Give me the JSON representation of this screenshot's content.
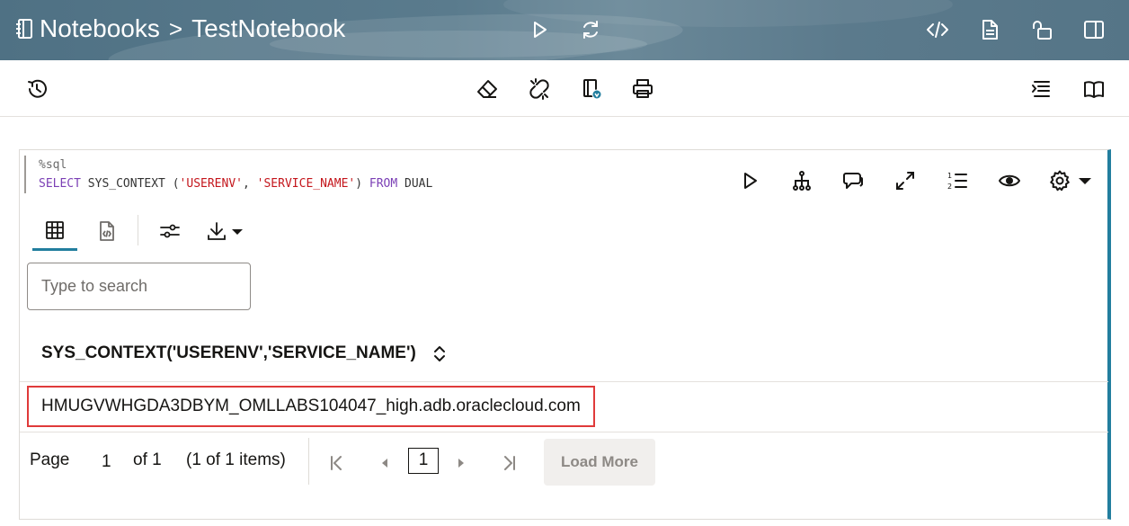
{
  "header": {
    "root": "Notebooks",
    "separator": ">",
    "notebook": "TestNotebook"
  },
  "paragraph": {
    "code_magic": "%sql",
    "code_line": {
      "kw_select": "SELECT",
      "fn": " SYS_CONTEXT (",
      "arg1": "'USERENV'",
      "comma": ", ",
      "arg2": "'SERVICE_NAME'",
      "close": ") ",
      "kw_from": "FROM",
      "table": " DUAL"
    },
    "search_placeholder": "Type to search",
    "column_header": "SYS_CONTEXT('USERENV','SERVICE_NAME')",
    "rows": [
      "HMUGVWHGDA3DBYM_OMLLABS104047_high.adb.oraclecloud.com"
    ],
    "pager": {
      "page_label": "Page",
      "page_number": "1",
      "of_label": "of 1",
      "items_label": "(1 of 1 items)",
      "current_page": "1",
      "load_more": "Load More"
    }
  },
  "colors": {
    "header_bg": "#557587",
    "accent": "#227e9e",
    "highlight_border": "#e03a3a",
    "keyword": "#7b3fb5",
    "string": "#c4161c"
  },
  "icons": {
    "header": [
      "notebook-icon",
      "run-icon",
      "refresh-icon",
      "code-icon",
      "document-icon",
      "unlock-icon",
      "panel-icon"
    ],
    "toolbar": [
      "history-icon",
      "eraser-icon",
      "unlink-icon",
      "export-icon",
      "print-icon",
      "toc-icon",
      "book-icon"
    ],
    "paragraph": [
      "run-paragraph-icon",
      "hierarchy-icon",
      "comment-icon",
      "expand-icon",
      "line-numbers-icon",
      "eye-icon",
      "gear-icon",
      "caret-down-icon"
    ]
  }
}
